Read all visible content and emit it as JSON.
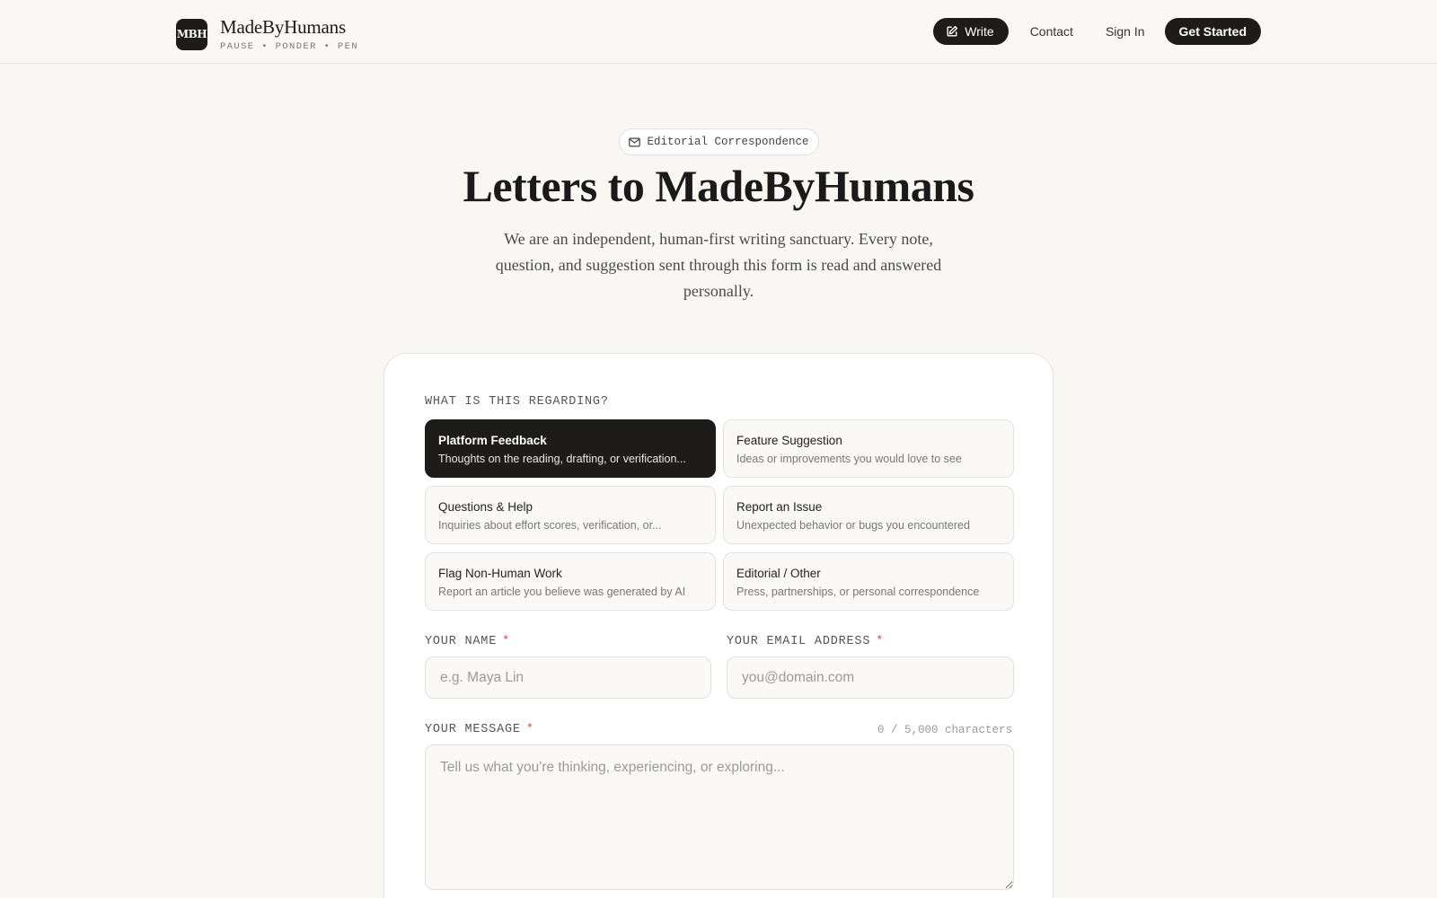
{
  "header": {
    "logo_text": "MBH",
    "brand_name": "MadeByHumans",
    "tagline": "PAUSE • PONDER • PEN",
    "write_label": "Write",
    "contact_label": "Contact",
    "signin_label": "Sign In",
    "get_started_label": "Get Started"
  },
  "hero": {
    "badge": "Editorial Correspondence",
    "title": "Letters to MadeByHumans",
    "subtitle": "We are an independent, human-first writing sanctuary. Every note, question, and suggestion sent through this form is read and answered personally."
  },
  "form": {
    "regarding_label": "WHAT IS THIS REGARDING?",
    "topics": [
      {
        "title": "Platform Feedback",
        "desc": "Thoughts on the reading, drafting, or verification...",
        "selected": true
      },
      {
        "title": "Feature Suggestion",
        "desc": "Ideas or improvements you would love to see",
        "selected": false
      },
      {
        "title": "Questions & Help",
        "desc": "Inquiries about effort scores, verification, or...",
        "selected": false
      },
      {
        "title": "Report an Issue",
        "desc": "Unexpected behavior or bugs you encountered",
        "selected": false
      },
      {
        "title": "Flag Non-Human Work",
        "desc": "Report an article you believe was generated by AI",
        "selected": false
      },
      {
        "title": "Editorial / Other",
        "desc": "Press, partnerships, or personal correspondence",
        "selected": false
      }
    ],
    "name_label": "YOUR NAME",
    "name_placeholder": "e.g. Maya Lin",
    "name_value": "",
    "email_label": "YOUR EMAIL ADDRESS",
    "email_placeholder": "you@domain.com",
    "email_value": "",
    "message_label": "YOUR MESSAGE",
    "message_placeholder": "Tell us what you're thinking, experiencing, or exploring...",
    "message_value": "",
    "char_counter": "0 / 5,000 characters",
    "required_mark": "*"
  },
  "icons": {
    "write": "pencil-square-icon",
    "badge": "envelope-icon"
  },
  "colors": {
    "background": "#f8f7f4",
    "primary": "#1d1c1b",
    "required": "#d84a4a",
    "card": "#ffffff"
  }
}
